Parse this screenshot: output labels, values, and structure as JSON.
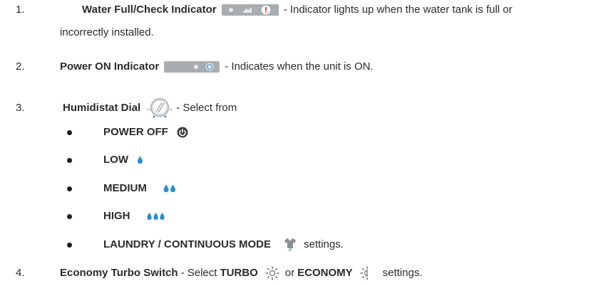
{
  "items": [
    {
      "num": "1.",
      "title": "Water Full/Check Indicator",
      "text": "- Indicator lights up when the water tank is full or",
      "text2": "incorrectly installed.",
      "icon": "water-full-indicator-panel-icon"
    },
    {
      "num": "2.",
      "title": "Power ON Indicator",
      "text": "- Indicates when the unit is ON.",
      "icon": "power-on-indicator-panel-icon"
    },
    {
      "num": "3.",
      "title": "Humidistat Dial",
      "text": "- Select from",
      "icon": "humidistat-dial-icon",
      "options": [
        {
          "label": "POWER OFF",
          "icon": "power-symbol-icon"
        },
        {
          "label": "LOW",
          "icon": "single-drop-icon"
        },
        {
          "label": "MEDIUM",
          "icon": "double-drop-icon"
        },
        {
          "label": "HIGH",
          "icon": "triple-drop-icon"
        },
        {
          "label": "LAUNDRY / CONTINUOUS MODE",
          "suffix": "settings.",
          "icon": "shirt-icon"
        }
      ]
    },
    {
      "num": "4.",
      "title": "Economy Turbo Switch",
      "text_a": "- Select",
      "turbo": "TURBO",
      "or": "or",
      "economy": "ECONOMY",
      "suffix": "settings.",
      "icons": [
        "turbo-sun-icon",
        "economy-sun-icon"
      ]
    }
  ],
  "colors": {
    "text": "#2b2b2b",
    "panel": "#a9adb2",
    "drop": "#2a8fd0",
    "alert": "#d6332f",
    "power_led": "#5aa8d8"
  }
}
